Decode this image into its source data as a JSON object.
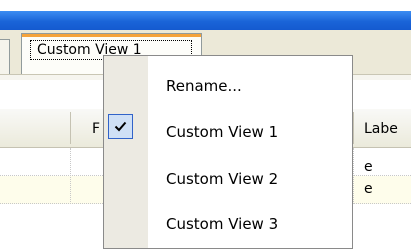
{
  "window": {
    "accent_color": "#1a64d8",
    "tab_highlight_color": "#f5a33b"
  },
  "tabs": [
    {
      "label": "Custom View 1",
      "active": true
    }
  ],
  "grid": {
    "columns": [
      {
        "label": "F"
      },
      {
        "label": "Labe"
      }
    ],
    "rows": [
      {
        "tail_text": "e"
      },
      {
        "tail_text": "e"
      }
    ]
  },
  "context_menu": {
    "items": [
      {
        "label": "Rename...",
        "checked": false
      },
      {
        "label": "Custom View 1",
        "checked": true,
        "icon": "check-icon"
      },
      {
        "label": "Custom View 2",
        "checked": false
      },
      {
        "label": "Custom View 3",
        "checked": false
      }
    ]
  }
}
